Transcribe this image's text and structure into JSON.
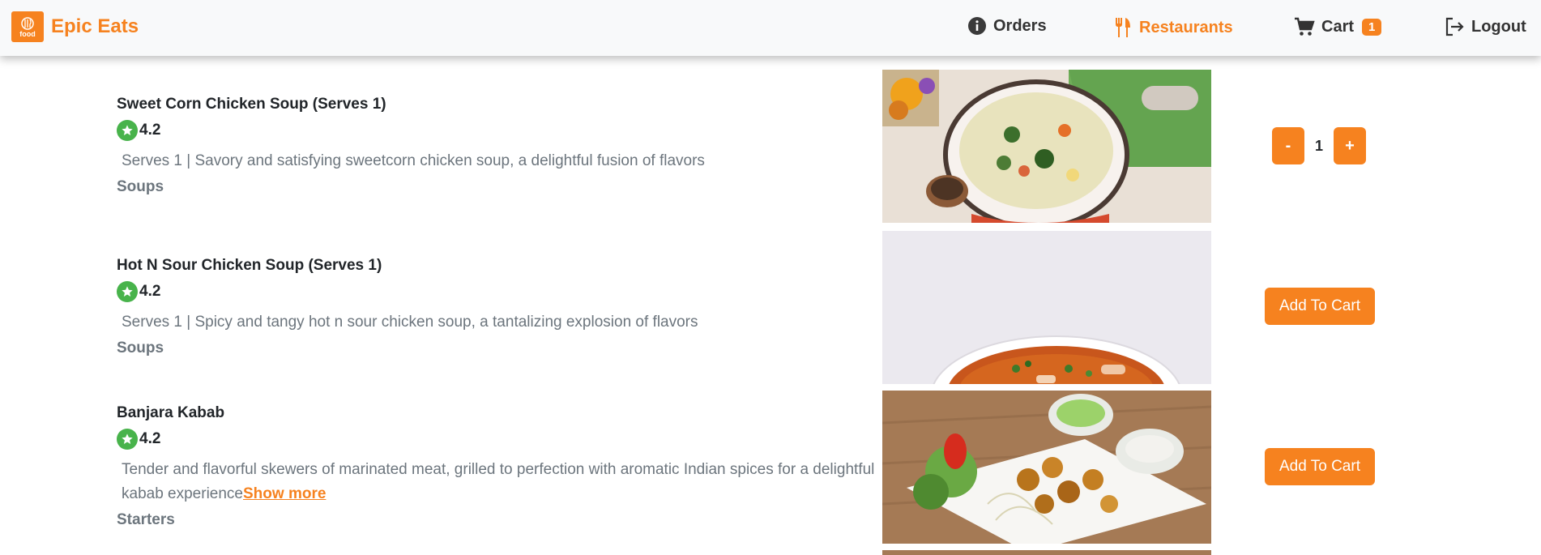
{
  "brand": {
    "name": "Epic Eats",
    "logo_text": "food"
  },
  "nav": {
    "orders": "Orders",
    "restaurants": "Restaurants",
    "cart": "Cart",
    "cart_count": "1",
    "logout": "Logout"
  },
  "items": [
    {
      "name": "Sweet Corn Chicken Soup (Serves 1)",
      "rating": "4.2",
      "description": "Serves 1 | Savory and satisfying sweetcorn chicken soup, a delightful fusion of flavors",
      "category": "Soups",
      "quantity": "1",
      "decrement_label": "-",
      "increment_label": "+"
    },
    {
      "name": "Hot N Sour Chicken Soup (Serves 1)",
      "rating": "4.2",
      "description": "Serves 1 | Spicy and tangy hot n sour chicken soup, a tantalizing explosion of flavors",
      "category": "Soups",
      "button_label": "Add To Cart"
    },
    {
      "name": "Banjara Kabab",
      "rating": "4.2",
      "description": "Tender and flavorful skewers of marinated meat, grilled to perfection with aromatic Indian spices for a delightful kabab experience",
      "show_more": "Show more",
      "category": "Starters",
      "button_label": "Add To Cart"
    }
  ],
  "colors": {
    "accent": "#f6821f",
    "rating_green": "#48b34b",
    "muted_text": "#6c757d"
  }
}
